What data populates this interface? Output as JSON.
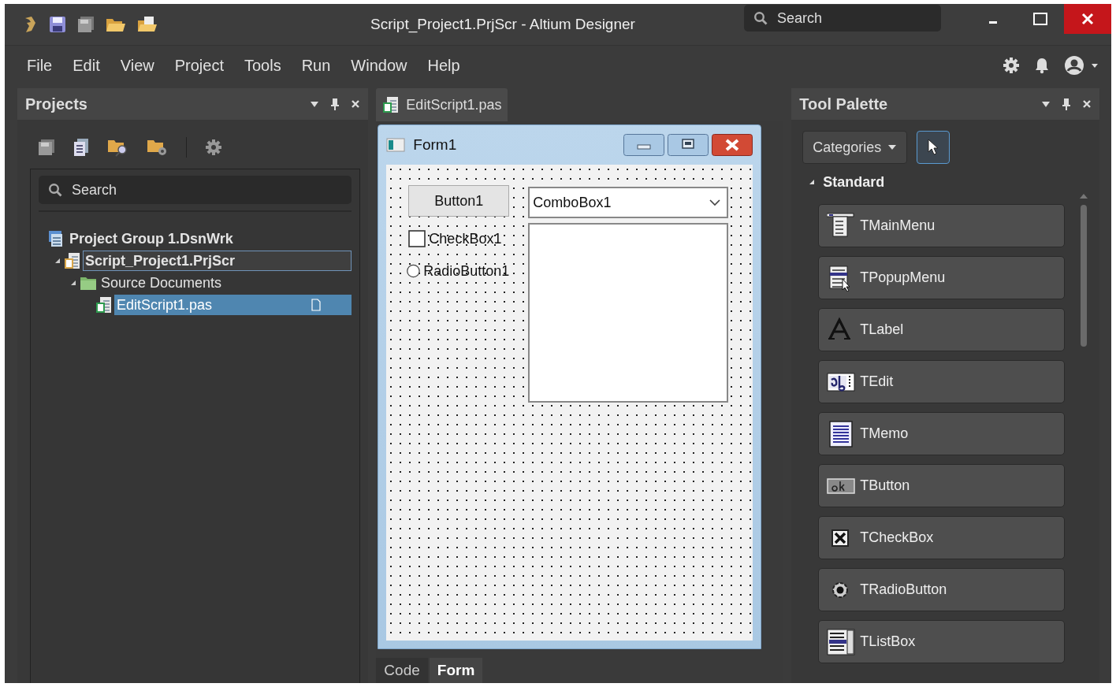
{
  "window": {
    "title": "Script_Project1.PrjScr - Altium Designer",
    "search": {
      "placeholder": "Search"
    }
  },
  "menu": [
    "File",
    "Edit",
    "View",
    "Project",
    "Tools",
    "Run",
    "Window",
    "Help"
  ],
  "projects_panel": {
    "title": "Projects",
    "search": {
      "placeholder": "Search"
    },
    "tree": [
      {
        "label": "Project Group 1.DsnWrk",
        "kind": "workspace",
        "selected": false,
        "focused": false,
        "children": [
          {
            "label": "Script_Project1.PrjScr",
            "kind": "project",
            "expanded": true,
            "selected": false,
            "focused": true,
            "children": [
              {
                "label": "Source Documents",
                "kind": "folder",
                "expanded": true,
                "selected": false,
                "focused": false,
                "children": [
                  {
                    "label": "EditScript1.pas",
                    "kind": "script",
                    "selected": true,
                    "focused": false
                  }
                ]
              }
            ]
          }
        ]
      }
    ]
  },
  "document": {
    "tabs": [
      {
        "label": "EditScript1.pas",
        "selected": true
      }
    ],
    "form": {
      "title": "Form1",
      "controls": [
        {
          "kind": "button",
          "label": "Button1"
        },
        {
          "kind": "combobox",
          "label": "ComboBox1"
        },
        {
          "kind": "checkbox",
          "label": "CheckBox1",
          "checked": false
        },
        {
          "kind": "listbox"
        },
        {
          "kind": "radio",
          "label": "RadioButton1",
          "selected": false
        }
      ]
    },
    "view_tabs": [
      {
        "label": "Code",
        "selected": false
      },
      {
        "label": "Form",
        "selected": true
      }
    ]
  },
  "tool_palette": {
    "title": "Tool Palette",
    "categories_button": "Categories",
    "pointer_selected": true,
    "section": {
      "label": "Standard",
      "expanded": true
    },
    "items": [
      {
        "label": "TMainMenu",
        "kind": "mainmenu"
      },
      {
        "label": "TPopupMenu",
        "kind": "popupmenu"
      },
      {
        "label": "TLabel",
        "kind": "label"
      },
      {
        "label": "TEdit",
        "kind": "edit"
      },
      {
        "label": "TMemo",
        "kind": "memo"
      },
      {
        "label": "TButton",
        "kind": "button"
      },
      {
        "label": "TCheckBox",
        "kind": "checkbox"
      },
      {
        "label": "TRadioButton",
        "kind": "radiobutton"
      },
      {
        "label": "TListBox",
        "kind": "listbox"
      }
    ]
  }
}
